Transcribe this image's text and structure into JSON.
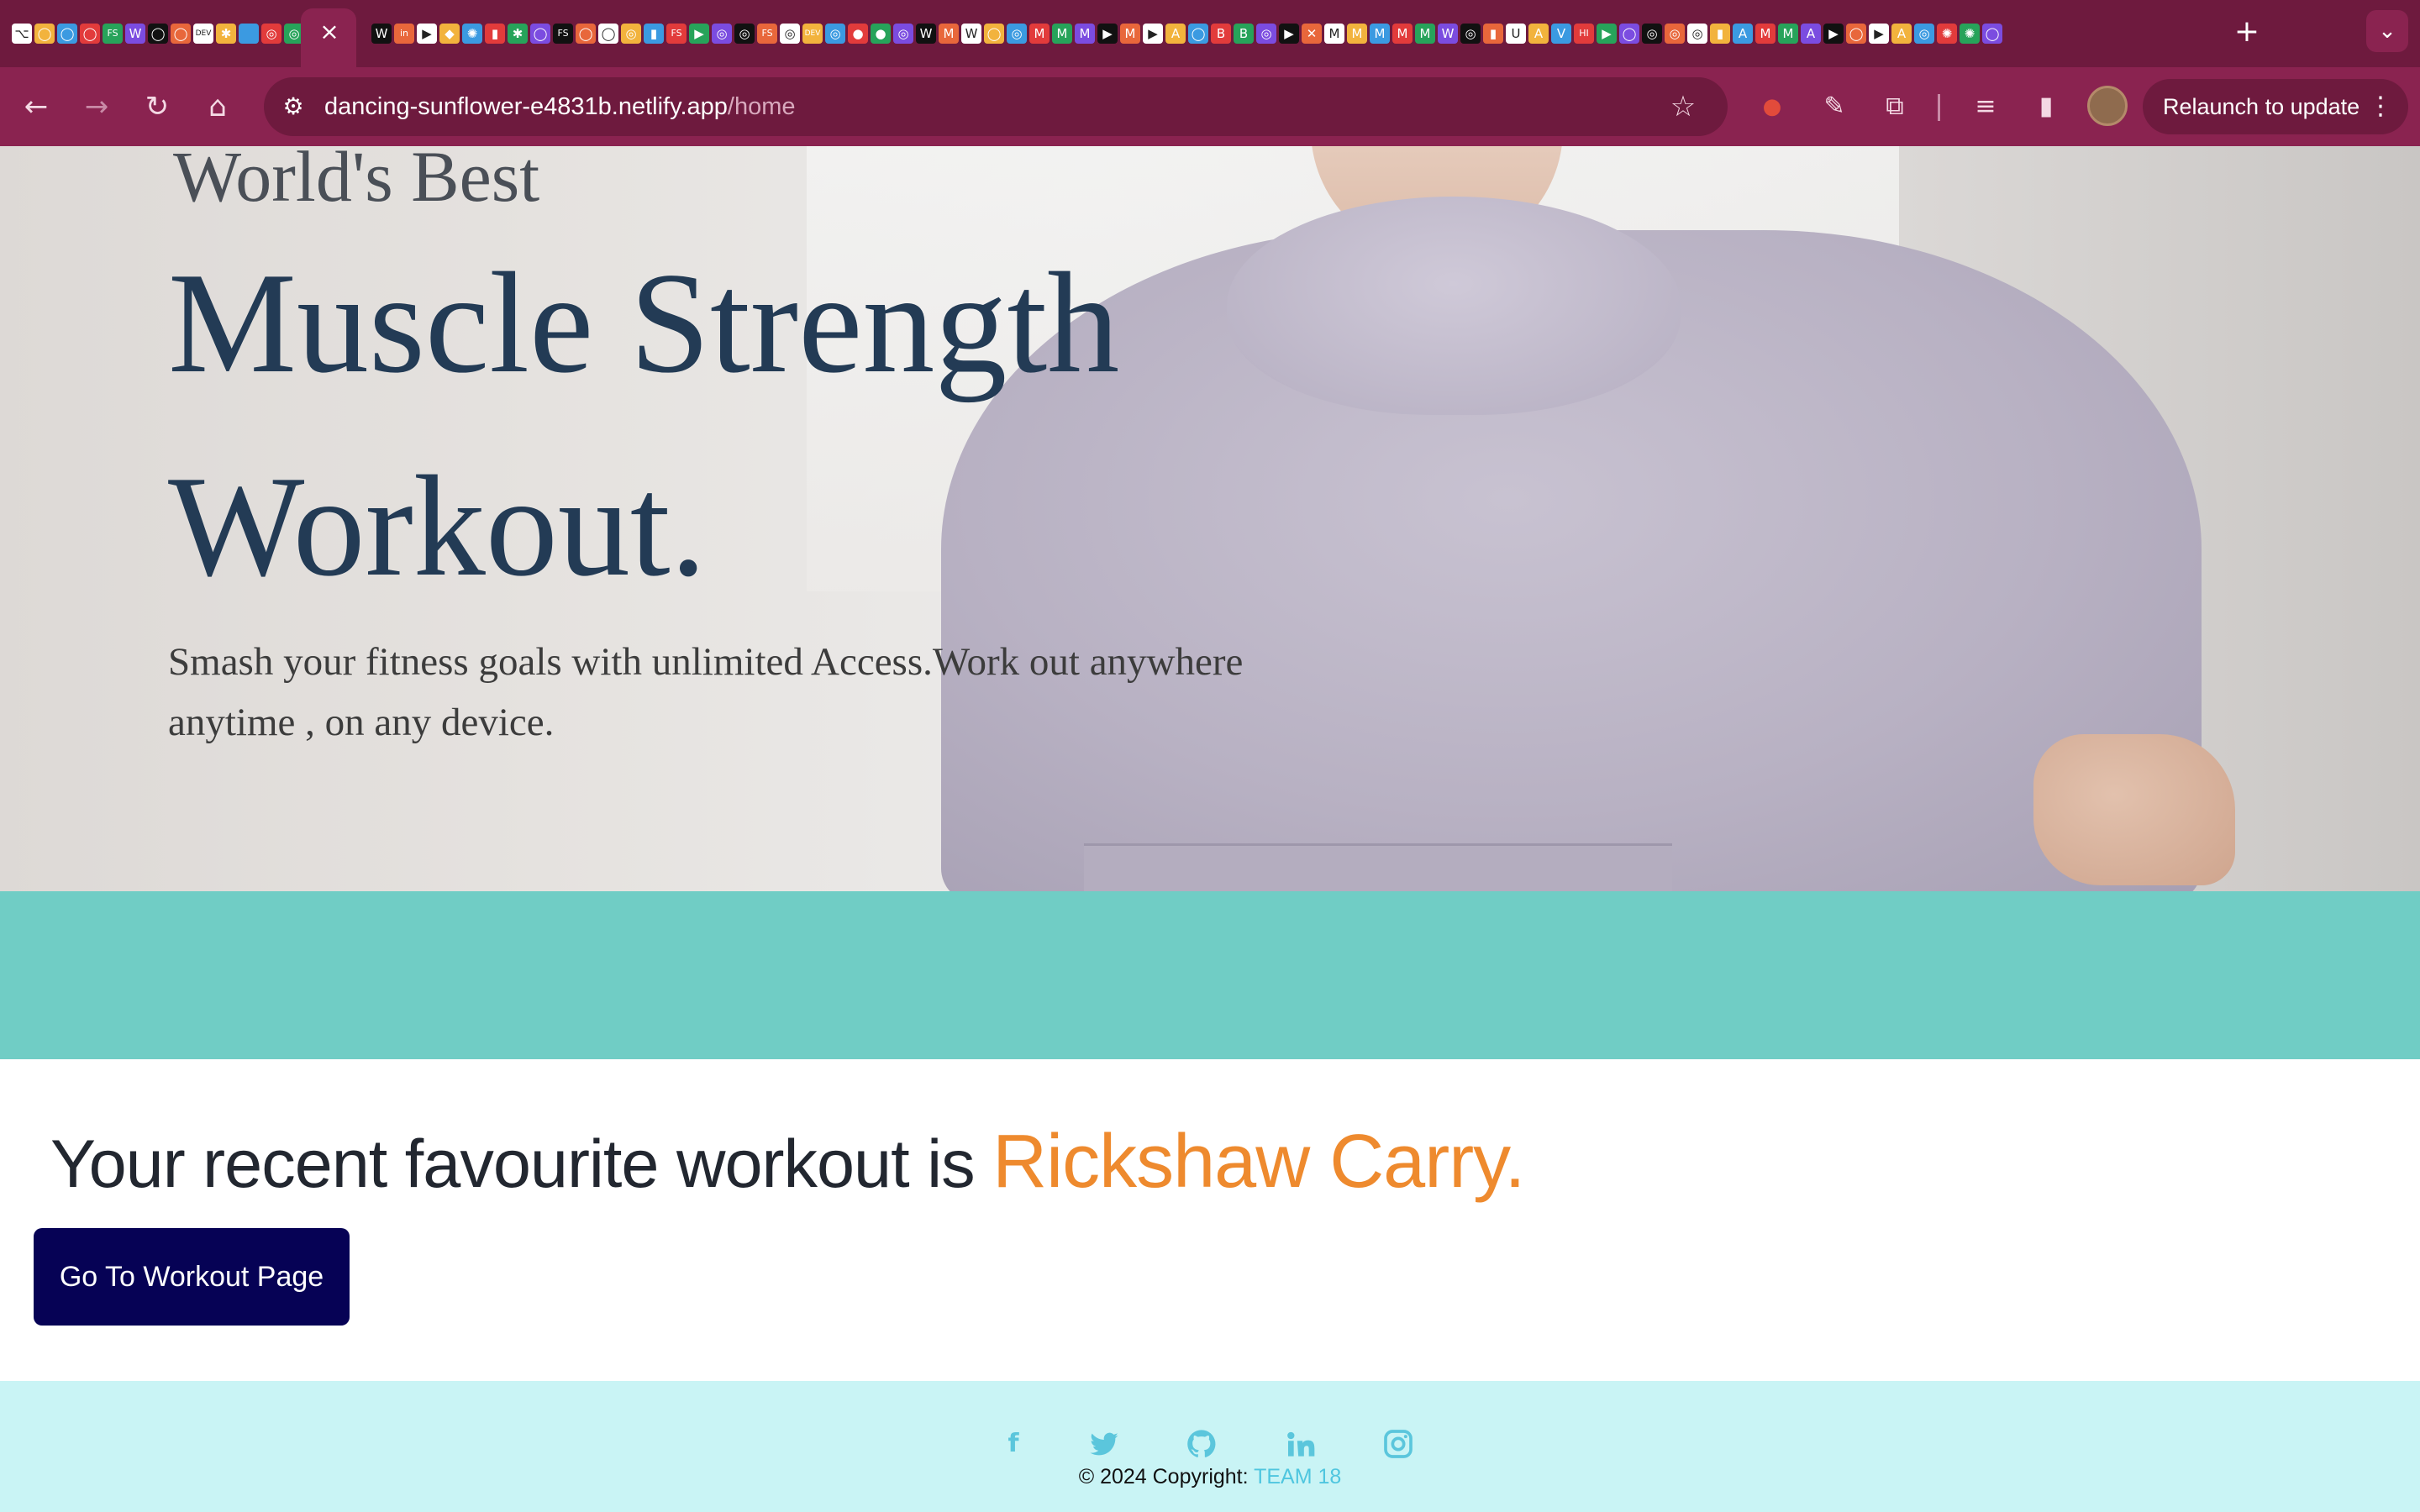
{
  "browser": {
    "active_tab_close": "×",
    "new_tab": "+",
    "tab_search": "⌄",
    "nav": {
      "back": "←",
      "forward": "→",
      "reload": "↻",
      "home": "⌂"
    },
    "site_info": "⚙",
    "url_host": "dancing-sunflower-e4831b.netlify.app",
    "url_path": "/home",
    "bookmark_star": "☆",
    "relaunch_label": "Relaunch to update",
    "menu_dots": "⋮",
    "favicons": [
      "⌥",
      "◯",
      "◯",
      "◯",
      "FS",
      "W",
      "◯",
      "◯",
      "DEV",
      "✱",
      "",
      "◎",
      "◎",
      "◯",
      "W",
      "in",
      "▶",
      "◆",
      "✺",
      "▮",
      "✱",
      "◯",
      "FS",
      "◯",
      "◯",
      "◎",
      "▮",
      "FS",
      "▶",
      "◎",
      "◎",
      "FS",
      "◎",
      "DEV",
      "◎",
      "●",
      "●",
      "◎",
      "W",
      "M",
      "W",
      "◯",
      "◎",
      "M",
      "M",
      "M",
      "▶",
      "M",
      "▶",
      "A",
      "◯",
      "B",
      "B",
      "◎",
      "▶",
      "✕",
      "M",
      "M",
      "M",
      "M",
      "M",
      "W",
      "◎",
      "▮",
      "U",
      "A",
      "V",
      "HI",
      "▶",
      "◯",
      "◎",
      "◎",
      "◎",
      "▮",
      "A",
      "M",
      "M",
      "A",
      "▶",
      "◯",
      "▶",
      "A",
      "◎",
      "✺",
      "✺",
      "◯"
    ]
  },
  "hero": {
    "kicker": "World's Best",
    "title_line1": "Muscle Strength",
    "title_line2": "Workout.",
    "description": "Smash your fitness goals with unlimited Access.Work out anywhere anytime , on any device."
  },
  "recent": {
    "prefix": "Your recent favourite workout is ",
    "workout": "Rickshaw Carry.",
    "button_label": "Go To Workout Page"
  },
  "footer": {
    "social_icons": [
      "facebook-icon",
      "twitter-icon",
      "github-icon",
      "linkedin-icon",
      "instagram-icon"
    ],
    "copyright_prefix": "© 2024 Copyright: ",
    "team": "TEAM 18"
  },
  "colors": {
    "tabstrip": "#6e1a3e",
    "toolbar": "#8a2350",
    "hero_title": "#233b55",
    "band": "#70cdc5",
    "accent_orange": "#ee8a2e",
    "button_navy": "#060255",
    "footer_bg": "#c9f4f5",
    "footer_icon": "#5bc6dc"
  }
}
